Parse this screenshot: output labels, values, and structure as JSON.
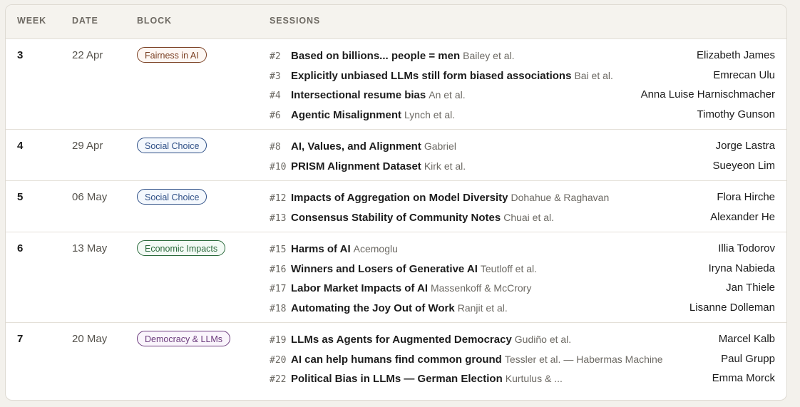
{
  "headers": {
    "week": "WEEK",
    "date": "DATE",
    "block": "BLOCK",
    "sessions": "SESSIONS"
  },
  "weeks": [
    {
      "week": "3",
      "date": "22 Apr",
      "block": {
        "label": "Fairness in AI",
        "color": "#7a3f22"
      },
      "sessions": [
        {
          "num": "#2",
          "title": "Based on billions... people = men",
          "authors": "Bailey et al.",
          "presenter": "Elizabeth James"
        },
        {
          "num": "#3",
          "title": "Explicitly unbiased LLMs still form biased associations",
          "authors": "Bai et al.",
          "presenter": "Emrecan Ulu"
        },
        {
          "num": "#4",
          "title": "Intersectional resume bias",
          "authors": "An et al.",
          "presenter": "Anna Luise Harnischmacher"
        },
        {
          "num": "#6",
          "title": "Agentic Misalignment",
          "authors": "Lynch et al.",
          "presenter": "Timothy Gunson"
        }
      ]
    },
    {
      "week": "4",
      "date": "29 Apr",
      "block": {
        "label": "Social Choice",
        "color": "#2e4f86"
      },
      "sessions": [
        {
          "num": "#8",
          "title": "AI, Values, and Alignment",
          "authors": "Gabriel",
          "presenter": "Jorge Lastra"
        },
        {
          "num": "#10",
          "title": "PRISM Alignment Dataset",
          "authors": "Kirk et al.",
          "presenter": "Sueyeon Lim"
        }
      ]
    },
    {
      "week": "5",
      "date": "06 May",
      "block": {
        "label": "Social Choice",
        "color": "#2e4f86"
      },
      "sessions": [
        {
          "num": "#12",
          "title": "Impacts of Aggregation on Model Diversity",
          "authors": "Dohahue & Raghavan",
          "presenter": "Flora Hirche"
        },
        {
          "num": "#13",
          "title": "Consensus Stability of Community Notes",
          "authors": "Chuai et al.",
          "presenter": "Alexander He"
        }
      ]
    },
    {
      "week": "6",
      "date": "13 May",
      "block": {
        "label": "Economic Impacts",
        "color": "#2b6a3c"
      },
      "sessions": [
        {
          "num": "#15",
          "title": "Harms of AI",
          "authors": "Acemoglu",
          "presenter": "Illia Todorov"
        },
        {
          "num": "#16",
          "title": "Winners and Losers of Generative AI",
          "authors": "Teutloff et al.",
          "presenter": "Iryna Nabieda"
        },
        {
          "num": "#17",
          "title": "Labor Market Impacts of AI",
          "authors": "Massenkoff & McCrory",
          "presenter": "Jan Thiele"
        },
        {
          "num": "#18",
          "title": "Automating the Joy Out of Work",
          "authors": "Ranjit et al.",
          "presenter": "Lisanne Dolleman"
        }
      ]
    },
    {
      "week": "7",
      "date": "20 May",
      "block": {
        "label": "Democracy & LLMs",
        "color": "#6b3a7c"
      },
      "sessions": [
        {
          "num": "#19",
          "title": "LLMs as Agents for Augmented Democracy",
          "authors": "Gudiño et al.",
          "presenter": "Marcel Kalb"
        },
        {
          "num": "#20",
          "title": "AI can help humans find common ground",
          "authors": "Tessler et al. — Habermas Machine",
          "presenter": "Paul Grupp"
        },
        {
          "num": "#22",
          "title": "Political Bias in LLMs — German Election",
          "authors": "Kurtulus & ...",
          "presenter": "Emma Morck"
        }
      ]
    }
  ]
}
